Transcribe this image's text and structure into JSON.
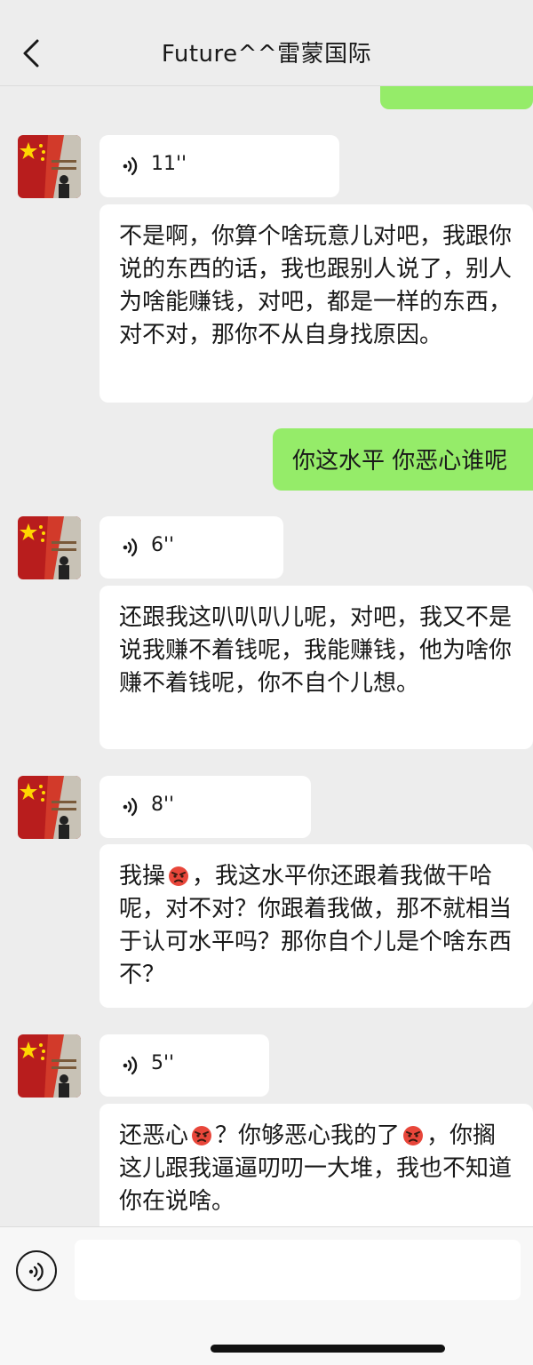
{
  "header": {
    "title": "Future^^雷蒙国际",
    "back_icon": "chevron-left-icon"
  },
  "messages": [
    {
      "sender": "contact",
      "voice_duration": "11''",
      "transcript": "不是啊，你算个啥玩意儿对吧，我跟你说的东西的话，我也跟别人说了，别人为啥能赚钱，对吧，都是一样的东西，对不对，那你不从自身找原因。"
    },
    {
      "sender": "me",
      "text": "你这水平 你恶心谁呢"
    },
    {
      "sender": "contact",
      "voice_duration": "6''",
      "transcript": "还跟我这叭叭叭儿呢，对吧，我又不是说我赚不着钱呢，我能赚钱，他为啥你赚不着钱呢，你不自个儿想。"
    },
    {
      "sender": "contact",
      "voice_duration": "8''",
      "transcript_parts": [
        "我操",
        "，我这水平你还跟着我做干哈呢，对不对？你跟着我做，那不就相当于认可水平吗？那你自个儿是个啥东西不？"
      ],
      "emoji": "angry-face-emoji"
    },
    {
      "sender": "contact",
      "voice_duration": "5''",
      "transcript_parts": [
        "还恶心",
        "？你够恶心我的了",
        "，你搁这儿跟我逼逼叨叨一大堆，我也不知道你在说啥。"
      ],
      "emoji": "angry-face-emoji"
    }
  ],
  "input": {
    "value": "",
    "voice_icon": "voice-input-icon"
  },
  "colors": {
    "background": "#ededed",
    "incoming_bubble": "#ffffff",
    "outgoing_bubble": "#95ec69"
  }
}
